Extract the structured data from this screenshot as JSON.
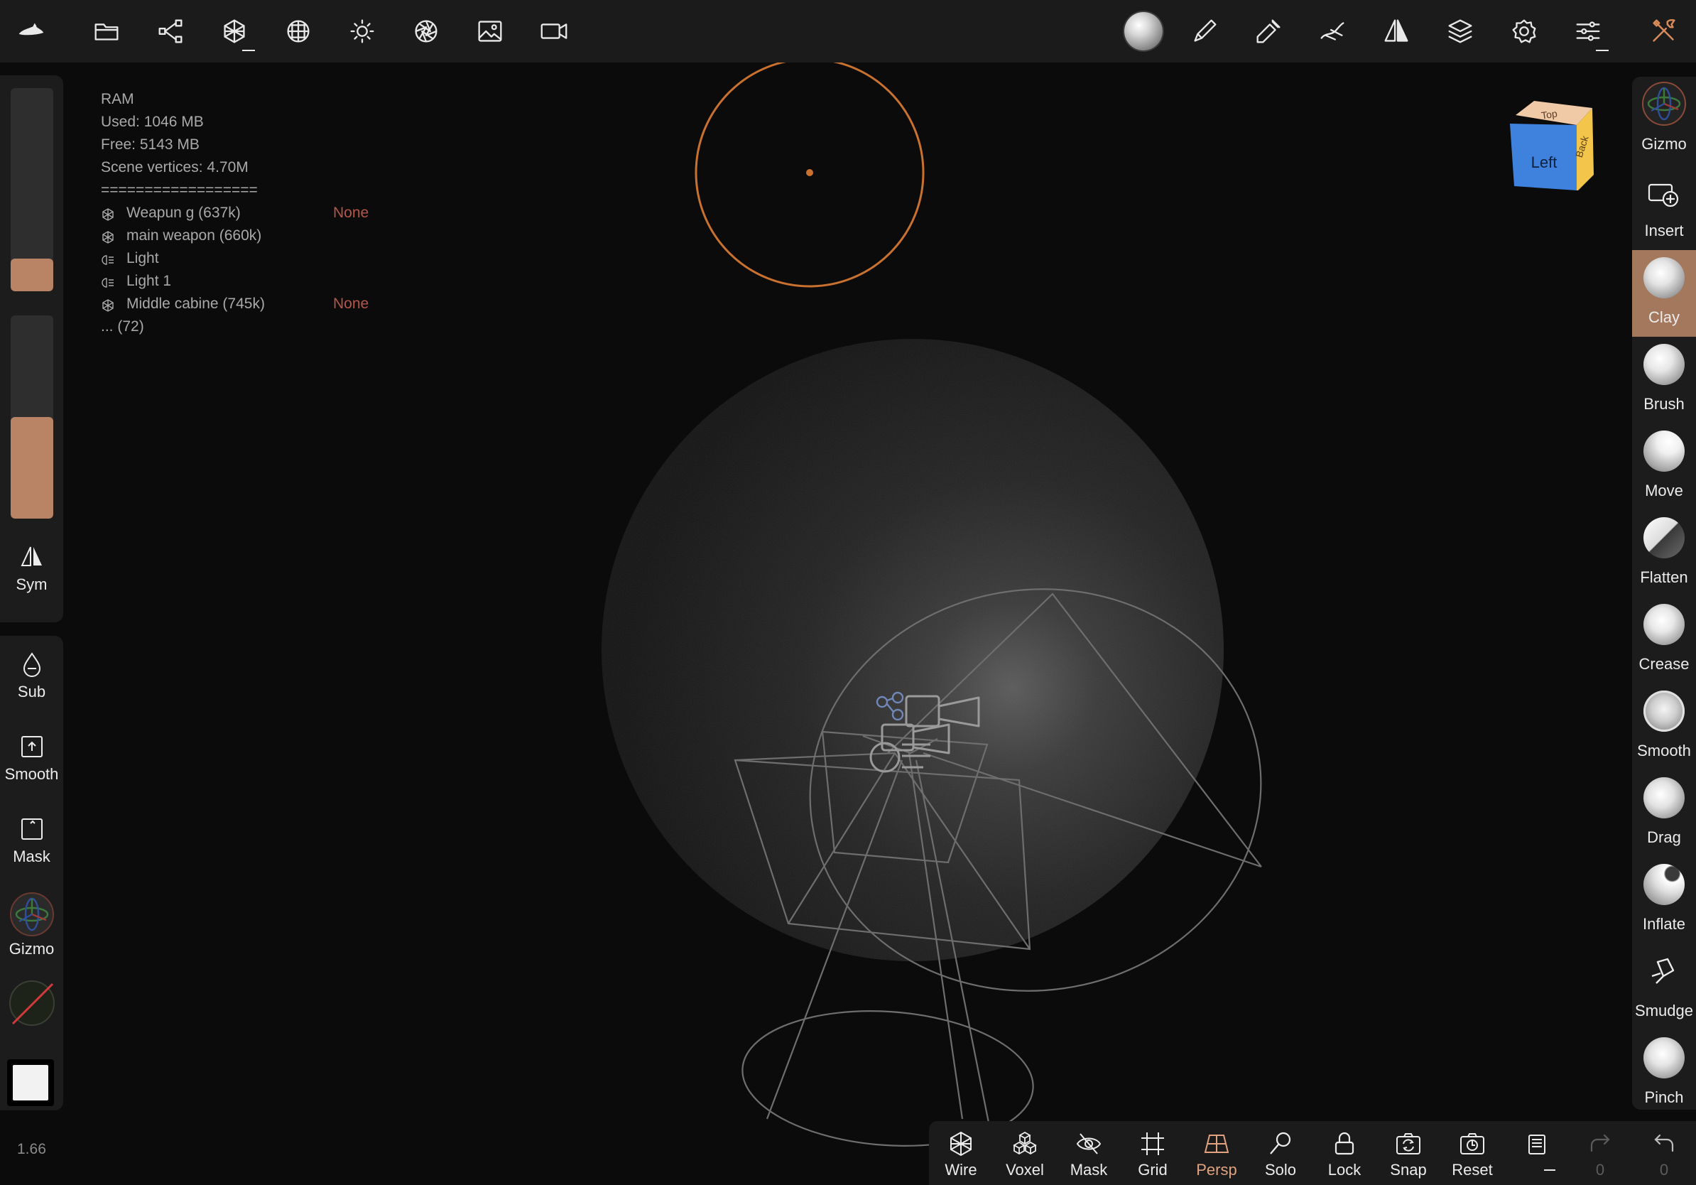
{
  "app": {
    "version": "1.66"
  },
  "topbar": {
    "left_icons": [
      "nomad-logo-icon",
      "folder-icon",
      "scene-graph-icon",
      "mesh-icon",
      "topology-icon",
      "light-icon",
      "camera-shutter-icon",
      "background-image-icon",
      "video-camera-icon"
    ],
    "right_icons": [
      "material-sphere-icon",
      "paint-brush-icon",
      "eyedropper-icon",
      "stroke-icon",
      "symmetry-icon",
      "layers-icon",
      "settings-icon",
      "tool-settings-icon",
      "tools-icon"
    ]
  },
  "info": {
    "ram_title": "RAM",
    "used": "Used: 1046 MB",
    "free": "Free: 5143 MB",
    "vertices": "Scene vertices: 4.70M",
    "separator": "==================",
    "objects": [
      {
        "icon": "mesh-icon",
        "label": "Weapun g (637k)",
        "status": "None"
      },
      {
        "icon": "mesh-icon",
        "label": "main weapon (660k)",
        "status": ""
      },
      {
        "icon": "light-object-icon",
        "label": "Light",
        "status": ""
      },
      {
        "icon": "light-object-icon",
        "label": "Light 1",
        "status": ""
      },
      {
        "icon": "mesh-icon",
        "label": "Middle cabine (745k)",
        "status": "None"
      }
    ],
    "more": "... (72)"
  },
  "left_panel": {
    "radius_slider": {
      "value": 0.16
    },
    "intensity_slider": {
      "value": 0.5
    },
    "sym_label": "Sym",
    "tools": [
      {
        "name": "sub",
        "label": "Sub"
      },
      {
        "name": "smooth",
        "label": "Smooth"
      },
      {
        "name": "mask",
        "label": "Mask"
      },
      {
        "name": "gizmo",
        "label": "Gizmo"
      }
    ]
  },
  "view_cube": {
    "front": "Left",
    "top": "Top",
    "side": "Back"
  },
  "right_tools": [
    {
      "label": "Gizmo",
      "active": false
    },
    {
      "label": "Insert",
      "active": false
    },
    {
      "label": "Clay",
      "active": true
    },
    {
      "label": "Brush",
      "active": false
    },
    {
      "label": "Move",
      "active": false
    },
    {
      "label": "Flatten",
      "active": false
    },
    {
      "label": "Crease",
      "active": false
    },
    {
      "label": "Smooth",
      "active": false
    },
    {
      "label": "Drag",
      "active": false
    },
    {
      "label": "Inflate",
      "active": false
    },
    {
      "label": "Smudge",
      "active": false
    },
    {
      "label": "Pinch",
      "active": false
    }
  ],
  "bottom_bar": {
    "items": [
      {
        "label": "Wire",
        "icon": "wireframe-icon"
      },
      {
        "label": "Voxel",
        "icon": "voxel-icon"
      },
      {
        "label": "Mask",
        "icon": "hide-mask-icon"
      },
      {
        "label": "Grid",
        "icon": "grid-icon"
      },
      {
        "label": "Persp",
        "icon": "perspective-icon"
      },
      {
        "label": "Solo",
        "icon": "solo-icon"
      },
      {
        "label": "Lock",
        "icon": "lock-icon"
      },
      {
        "label": "Snap",
        "icon": "snap-icon"
      },
      {
        "label": "Reset",
        "icon": "reset-camera-icon"
      }
    ],
    "redo_count": "0",
    "undo_count": "0"
  },
  "colors": {
    "accent": "#b98466",
    "active_tool": "#a4785c",
    "brush_ring": "#c9712e",
    "status_none": "#b4564a"
  }
}
